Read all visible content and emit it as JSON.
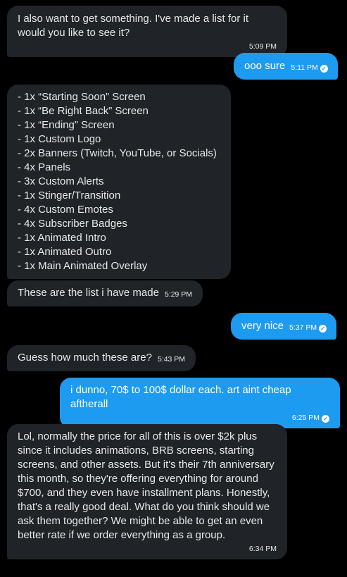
{
  "messages": [
    {
      "dir": "in",
      "text": "I also want to get something. I've made a list for it would you like to see it?",
      "time": "5:09 PM"
    },
    {
      "dir": "out",
      "text": "ooo sure",
      "time": "5:11 PM",
      "read": true
    },
    {
      "dir": "in",
      "list": [
        "- 1x “Starting Soon” Screen",
        "- 1x “Be Right Back” Screen",
        "- 1x “Ending” Screen",
        "- 1x Custom Logo",
        "- 2x Banners (Twitch, YouTube, or Socials)",
        "- 4x Panels",
        "- 3x Custom Alerts",
        "- 1x Stinger/Transition",
        "- 4x Custom Emotes",
        "- 4x Subscriber Badges",
        "- 1x Animated Intro",
        "- 1x Animated Outro",
        "- 1x Main Animated Overlay"
      ]
    },
    {
      "dir": "in",
      "text": "These are the list i have made",
      "time": "5:29 PM"
    },
    {
      "dir": "out",
      "text": "very nice",
      "time": "5:37 PM",
      "read": true
    },
    {
      "dir": "in",
      "text": "Guess how much these are?",
      "time": "5:43 PM"
    },
    {
      "dir": "out",
      "text": "i dunno, 70$ to 100$ dollar each. art aint cheap aftherall",
      "time": "6:25 PM",
      "read": true
    },
    {
      "dir": "in",
      "text": "Lol, normally the price for all of this is over $2k plus since it includes animations, BRB screens, starting screens, and other assets. But it's their 7th anniversary this month, so they're offering everything for around $700, and they even have installment plans. Honestly, that's a really good deal. What do you think should we ask them together? We might be able to get an even better rate if we order everything as a group.",
      "time": "6:34 PM"
    }
  ],
  "icons": {
    "read_receipt": "check-circle-icon"
  },
  "colors": {
    "background": "#000000",
    "incoming": "#202327",
    "outgoing": "#1d9bf0"
  }
}
